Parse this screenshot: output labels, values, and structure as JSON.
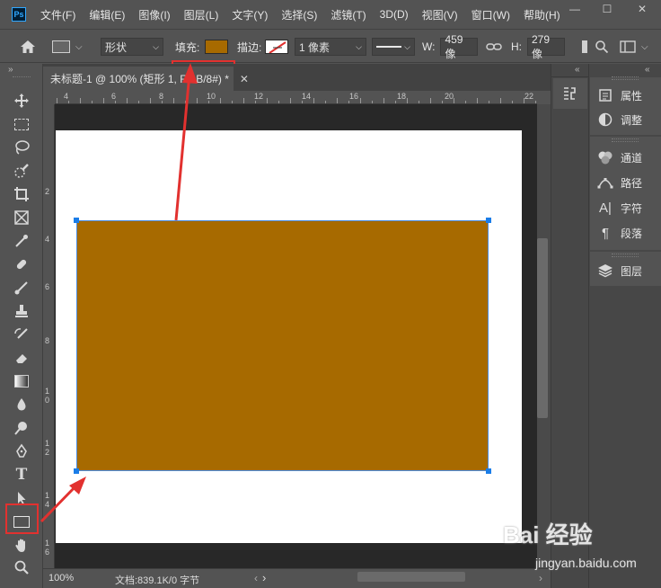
{
  "menu": {
    "logo": "Ps",
    "items": [
      "文件(F)",
      "编辑(E)",
      "图像(I)",
      "图层(L)",
      "文字(Y)",
      "选择(S)",
      "滤镜(T)",
      "3D(D)",
      "视图(V)",
      "窗口(W)",
      "帮助(H)"
    ],
    "minimize": "—",
    "maximize": "☐",
    "close": "✕"
  },
  "options": {
    "mode": "形状",
    "fill_label": "填充:",
    "fill_color": "#a76a00",
    "stroke_label": "描边:",
    "stroke_width": "1 像素",
    "w_label": "W:",
    "w_value": "459 像",
    "h_label": "H:",
    "h_value": "279 像"
  },
  "document": {
    "tab_title": "未标题-1 @ 100% (矩形 1, RGB/8#) *",
    "shape_color": "#a76a00",
    "ruler_top": [
      "4",
      "6",
      "8",
      "10",
      "12",
      "14",
      "16",
      "18",
      "20",
      "22"
    ],
    "ruler_left": [
      "2",
      "4",
      "6",
      "8",
      "10",
      "12",
      "14",
      "16"
    ]
  },
  "status": {
    "zoom": "100%",
    "doc_info": "文档:839.1K/0 字节",
    "arrow": "›"
  },
  "panels": {
    "properties": "属性",
    "adjustments": "调整",
    "channels": "通道",
    "paths": "路径",
    "character": "字符",
    "paragraph": "段落",
    "layers": "图层"
  },
  "watermark": {
    "brand": "Bai 经验",
    "url": "jingyan.baidu.com"
  }
}
